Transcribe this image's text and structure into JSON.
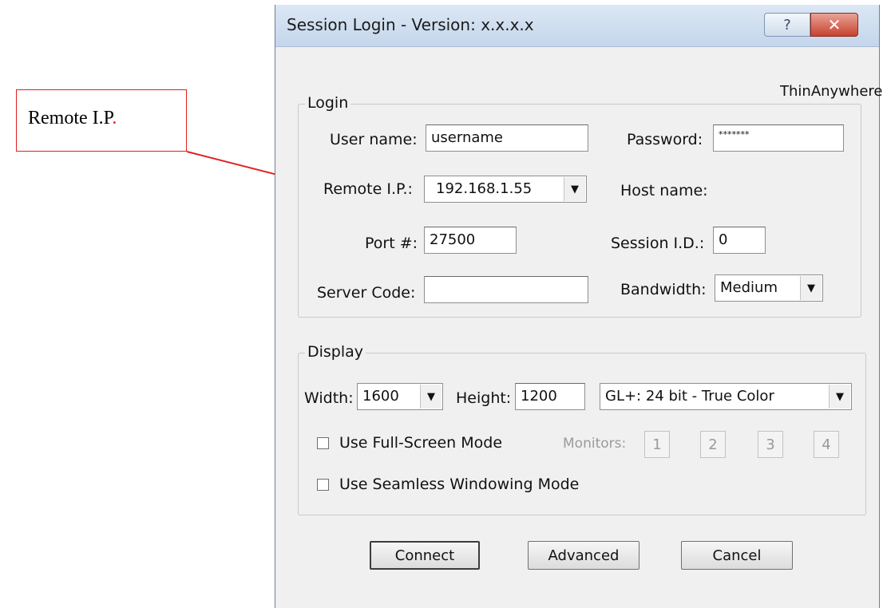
{
  "callout": {
    "text": "Remote I.P",
    "dot": "."
  },
  "window": {
    "title": "Session Login - Version: x.x.x.x",
    "help_glyph": "?",
    "close_glyph": "✕",
    "brand": "ThinAnywhere"
  },
  "login": {
    "legend": "Login",
    "username_label": "User name:",
    "username_value": "username",
    "password_label": "Password:",
    "password_value": "*******",
    "remote_ip_label": "Remote I.P.:",
    "remote_ip_value": "192.168.1.55",
    "host_name_label": "Host name:",
    "port_label": "Port #:",
    "port_value": "27500",
    "session_id_label": "Session I.D.:",
    "session_id_value": "0",
    "server_code_label": "Server Code:",
    "server_code_value": "",
    "bandwidth_label": "Bandwidth:",
    "bandwidth_value": "Medium"
  },
  "display": {
    "legend": "Display",
    "width_label": "Width:",
    "width_value": "1600",
    "height_label": "Height:",
    "height_value": "1200",
    "color_mode_value": "GL+: 24 bit - True Color",
    "fullscreen_label": "Use Full-Screen Mode",
    "monitors_label": "Monitors:",
    "monitors": [
      "1",
      "2",
      "3",
      "4"
    ],
    "seamless_label": "Use Seamless Windowing Mode"
  },
  "buttons": {
    "connect": "Connect",
    "advanced": "Advanced",
    "cancel": "Cancel"
  },
  "colors": {
    "callout_border": "#e02020",
    "arrow": "#e02020",
    "close_button": "#c8422e"
  }
}
